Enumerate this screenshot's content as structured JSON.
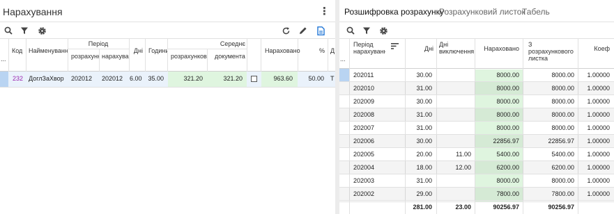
{
  "left": {
    "title": "Нарахування",
    "headers": {
      "kod": "Код",
      "name": "Найменування",
      "period": "Період",
      "period_calc": "розрахунку",
      "period_accr": "нарахування",
      "days": "Дні",
      "hours": "Години",
      "avg": "Середнє",
      "avg_calc": "розрахунковое",
      "avg_doc": "документа",
      "accrued": "Нараховано",
      "pct": "%",
      "d": "Д",
      "dots": "..."
    },
    "row": {
      "kod": "232",
      "name": "ДоглЗаХвор",
      "period_calc": "202012",
      "period_accr": "202012",
      "days": "6.00",
      "hours": "35.00",
      "avg_calc": "321.20",
      "avg_doc": "321.20",
      "accrued": "963.60",
      "pct": "50.00",
      "d": "Т"
    }
  },
  "right": {
    "tabs": [
      "Розшифровка розрахунку",
      "Розрахунковий листок",
      "Табель"
    ],
    "headers": {
      "period": "Період нарахування",
      "days": "Дні",
      "days_excl": "Дні виключення",
      "accrued": "Нараховано",
      "from_calc": "З розрахункового листка",
      "coef": "Коеф",
      "dots": "..."
    },
    "rows": [
      {
        "period": "202011",
        "days": "30.00",
        "excl": "",
        "accrued": "8000.00",
        "from_calc": "8000.00",
        "coef": "1.00000"
      },
      {
        "period": "202010",
        "days": "31.00",
        "excl": "",
        "accrued": "8000.00",
        "from_calc": "8000.00",
        "coef": "1.00000"
      },
      {
        "period": "202009",
        "days": "30.00",
        "excl": "",
        "accrued": "8000.00",
        "from_calc": "8000.00",
        "coef": "1.00000"
      },
      {
        "period": "202008",
        "days": "31.00",
        "excl": "",
        "accrued": "8000.00",
        "from_calc": "8000.00",
        "coef": "1.00000"
      },
      {
        "period": "202007",
        "days": "31.00",
        "excl": "",
        "accrued": "8000.00",
        "from_calc": "8000.00",
        "coef": "1.00000"
      },
      {
        "period": "202006",
        "days": "30.00",
        "excl": "",
        "accrued": "22856.97",
        "from_calc": "22856.97",
        "coef": "1.00000"
      },
      {
        "period": "202005",
        "days": "20.00",
        "excl": "11.00",
        "accrued": "5400.00",
        "from_calc": "5400.00",
        "coef": "1.00000"
      },
      {
        "period": "202004",
        "days": "18.00",
        "excl": "12.00",
        "accrued": "6200.00",
        "from_calc": "6200.00",
        "coef": "1.00000"
      },
      {
        "period": "202003",
        "days": "31.00",
        "excl": "",
        "accrued": "8000.00",
        "from_calc": "8000.00",
        "coef": "1.00000"
      },
      {
        "period": "202002",
        "days": "29.00",
        "excl": "",
        "accrued": "7800.00",
        "from_calc": "7800.00",
        "coef": "1.00000"
      }
    ],
    "totals": {
      "days": "281.00",
      "excl": "23.00",
      "accrued": "90256.97",
      "from_calc": "90256.97"
    }
  }
}
